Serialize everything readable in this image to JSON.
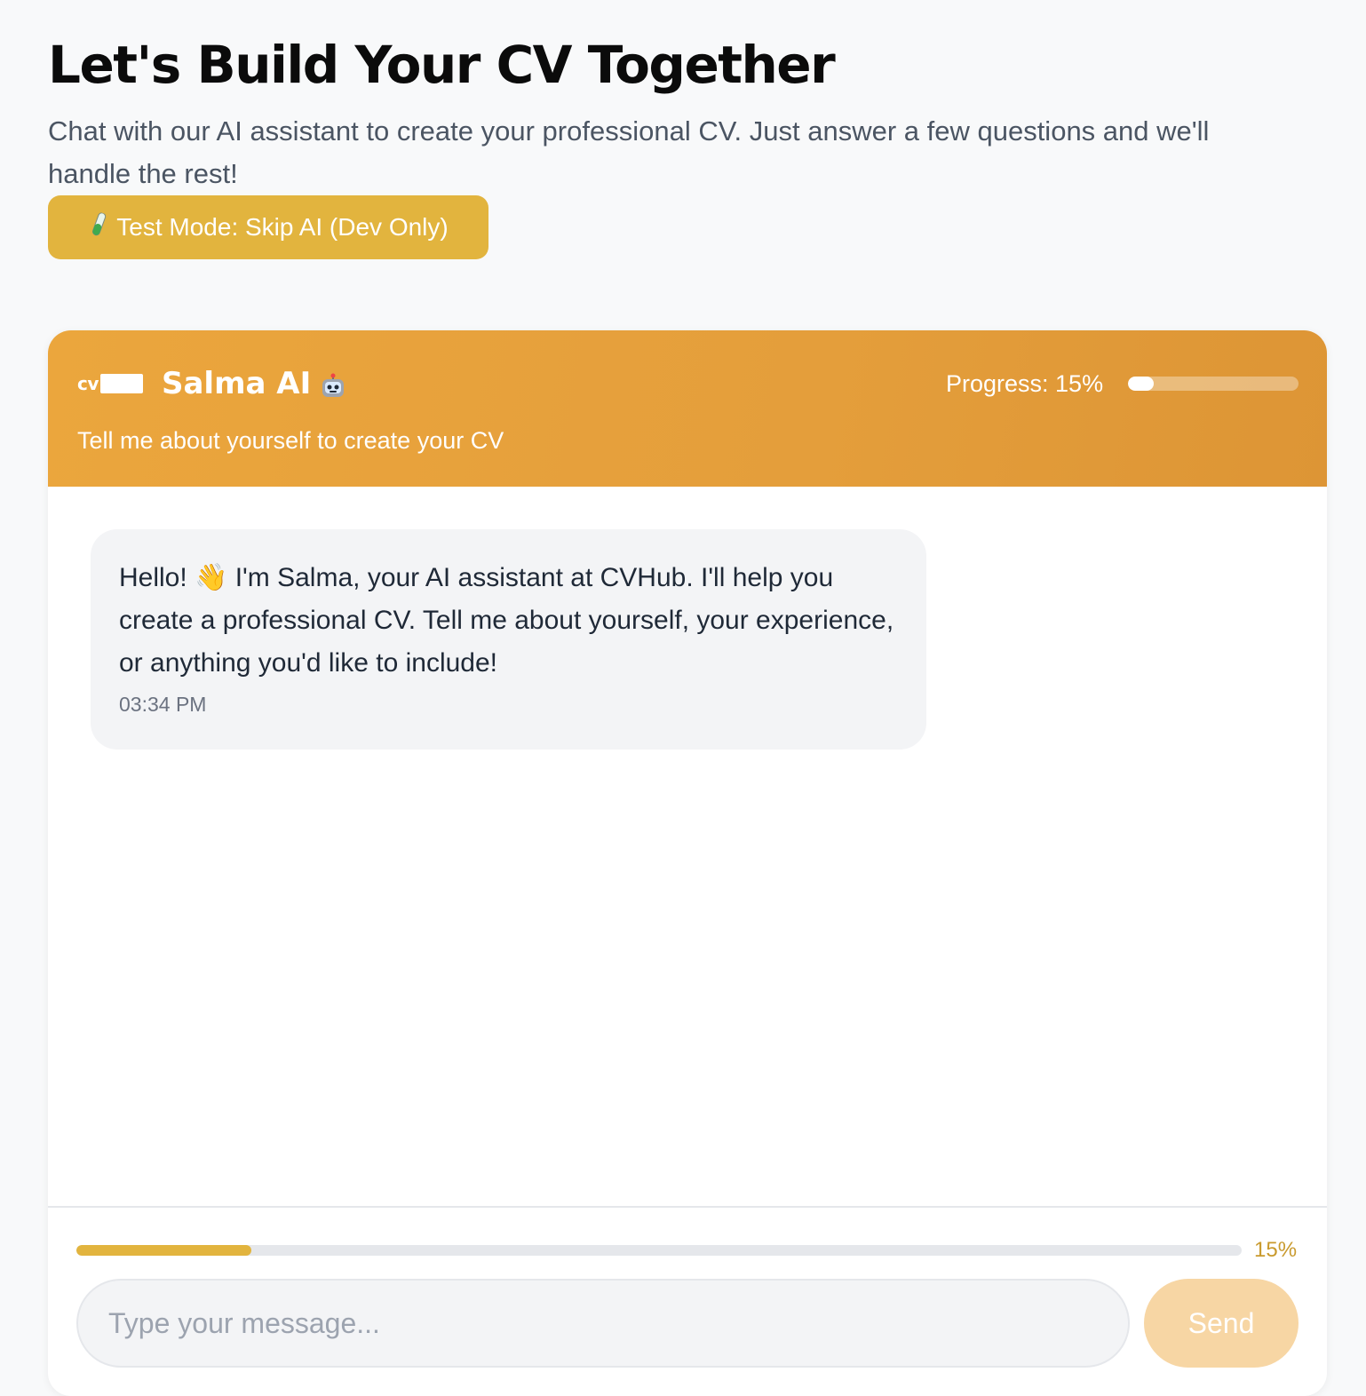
{
  "page": {
    "title": "Let's Build Your CV Together",
    "subtitle": "Chat with our AI assistant to create your professional CV. Just answer a few questions and we'll handle the rest!",
    "test_button_label": "Test Mode: Skip AI (Dev Only)",
    "test_button_icon": "test-tube-icon"
  },
  "chat": {
    "logo_text": "cv",
    "assistant_name": "Salma AI",
    "assistant_icon": "robot-icon",
    "header_subtitle": "Tell me about yourself to create your CV",
    "progress_label": "Progress: 15%",
    "progress_percent": 15,
    "messages": [
      {
        "sender": "assistant",
        "text": "Hello! 👋 I'm Salma, your AI assistant at CVHub. I'll help you create a professional CV. Tell me about yourself, your experience, or anything you'd like to include!",
        "time": "03:34 PM"
      }
    ],
    "footer_progress_label": "15%",
    "input": {
      "value": "",
      "placeholder": "Type your message..."
    },
    "send_label": "Send"
  },
  "colors": {
    "accent": "#e2b43e",
    "header_gradient_start": "#eba63d",
    "header_gradient_end": "#dd9535",
    "send_disabled": "#f7d6a4",
    "page_background": "#f8f9fa"
  }
}
